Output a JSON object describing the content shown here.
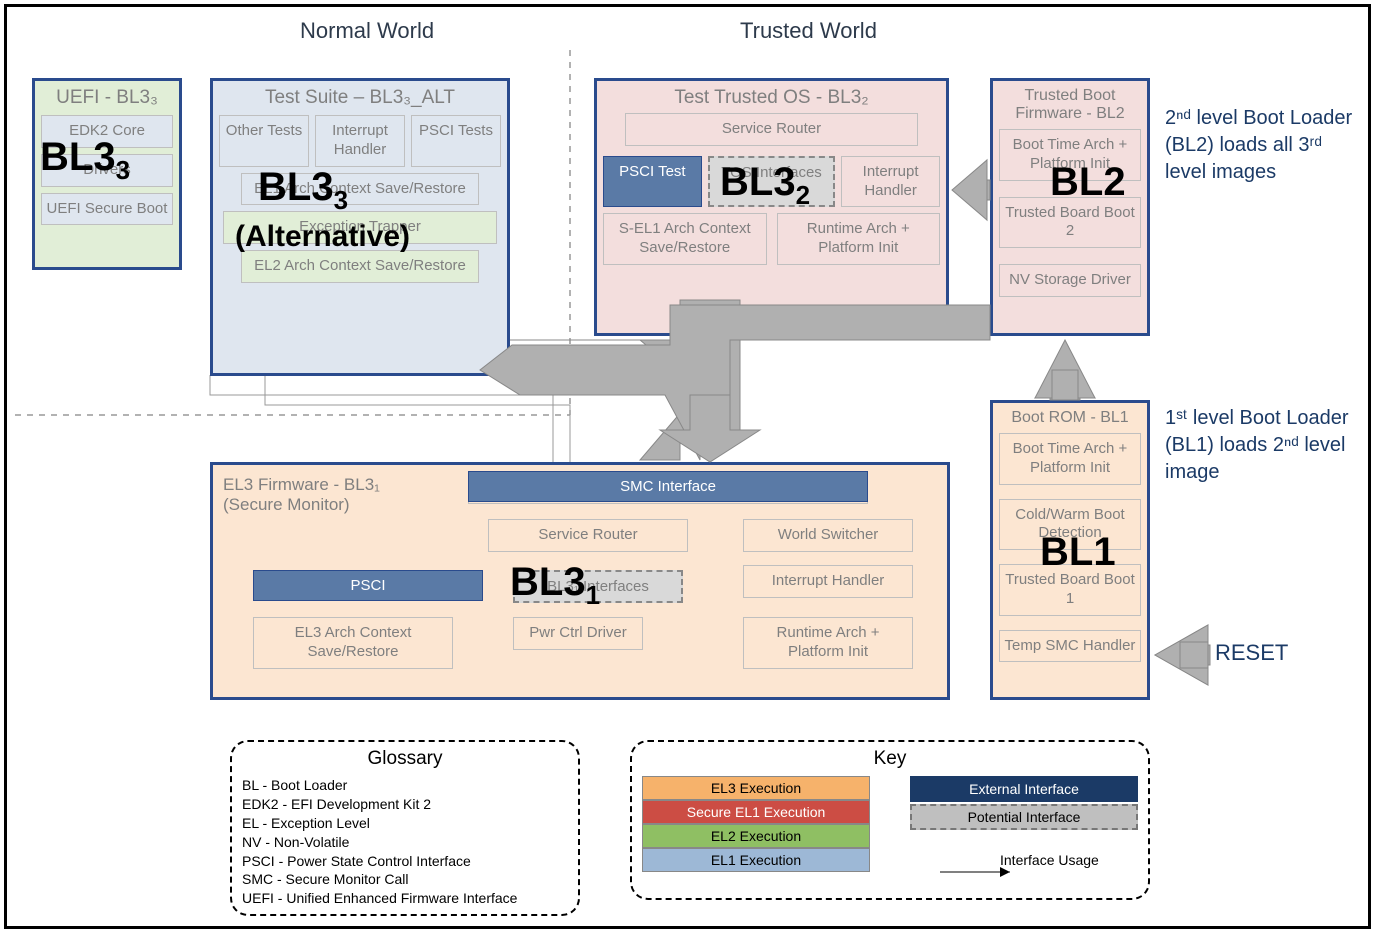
{
  "headers": {
    "normal": "Normal World",
    "trusted": "Trusted World"
  },
  "bigLabels": {
    "bl33": "BL3",
    "bl33sub": "3",
    "bl33alt": "BL3",
    "bl33altsub": "3",
    "bl33alt2": "(Alternative)",
    "bl32": "BL3",
    "bl32sub": "2",
    "bl2": "BL2",
    "bl31": "BL3",
    "bl31sub": "1",
    "bl1": "BL1",
    "reset": "RESET"
  },
  "uefi": {
    "title": "UEFI - BL3₃",
    "items": [
      "EDK2 Core",
      "Drivers",
      "UEFI Secure Boot"
    ]
  },
  "testSuite": {
    "title": "Test Suite – BL3₃_ALT",
    "row1": [
      "Other Tests",
      "Interrupt Handler",
      "PSCI Tests"
    ],
    "arch": "EL1 Arch Context Save/Restore",
    "trap": "Exception Trapper",
    "el2": "EL2 Arch Context Save/Restore"
  },
  "testOS": {
    "title": "Test Trusted OS - BL3₂",
    "router": "Service Router",
    "psci": "PSCI Test",
    "tos": "TOS Interfaces",
    "intr": "Interrupt Handler",
    "sel1": "S-EL1 Arch Context Save/Restore",
    "rt": "Runtime Arch + Platform Init"
  },
  "bl2": {
    "title": "Trusted Boot Firmware - BL2",
    "items": [
      "Boot Time Arch + Platform Init",
      "Trusted Board Boot 2",
      "NV Storage Driver"
    ]
  },
  "el3": {
    "title1": "EL3 Firmware - BL3₁",
    "title2": "(Secure Monitor)",
    "smc": "SMC Interface",
    "router": "Service Router",
    "world": "World Switcher",
    "psci": "PSCI",
    "intf": "BL3₁ Interfaces",
    "intr": "Interrupt Handler",
    "ctx": "EL3 Arch Context Save/Restore",
    "pwr": "Pwr Ctrl Driver",
    "rt": "Runtime Arch + Platform Init"
  },
  "bl1": {
    "title": "Boot ROM - BL1",
    "items": [
      "Boot Time Arch + Platform Init",
      "Cold/Warm Boot Detection",
      "Trusted Board Boot 1",
      "Temp SMC Handler"
    ]
  },
  "annotations": {
    "a1": "2ⁿᵈ level Boot Loader (BL2) loads all 3ʳᵈ level images",
    "a2": "1ˢᵗ level Boot Loader (BL1) loads 2ⁿᵈ level image"
  },
  "glossary": {
    "title": "Glossary",
    "lines": [
      "BL - Boot Loader",
      "EDK2 - EFI Development Kit 2",
      "EL - Exception Level",
      "NV - Non-Volatile",
      "PSCI - Power State Control Interface",
      "SMC - Secure Monitor Call",
      "UEFI - Unified Enhanced Firmware Interface"
    ]
  },
  "key": {
    "title": "Key",
    "left": [
      "EL3 Execution",
      "Secure EL1 Execution",
      "EL2 Execution",
      "EL1 Execution"
    ],
    "leftColors": [
      "#f6b26b",
      "#cc4d44",
      "#8fbf63",
      "#9db8d6"
    ],
    "right": [
      "External Interface",
      "Potential Interface",
      "Interface Usage"
    ]
  }
}
